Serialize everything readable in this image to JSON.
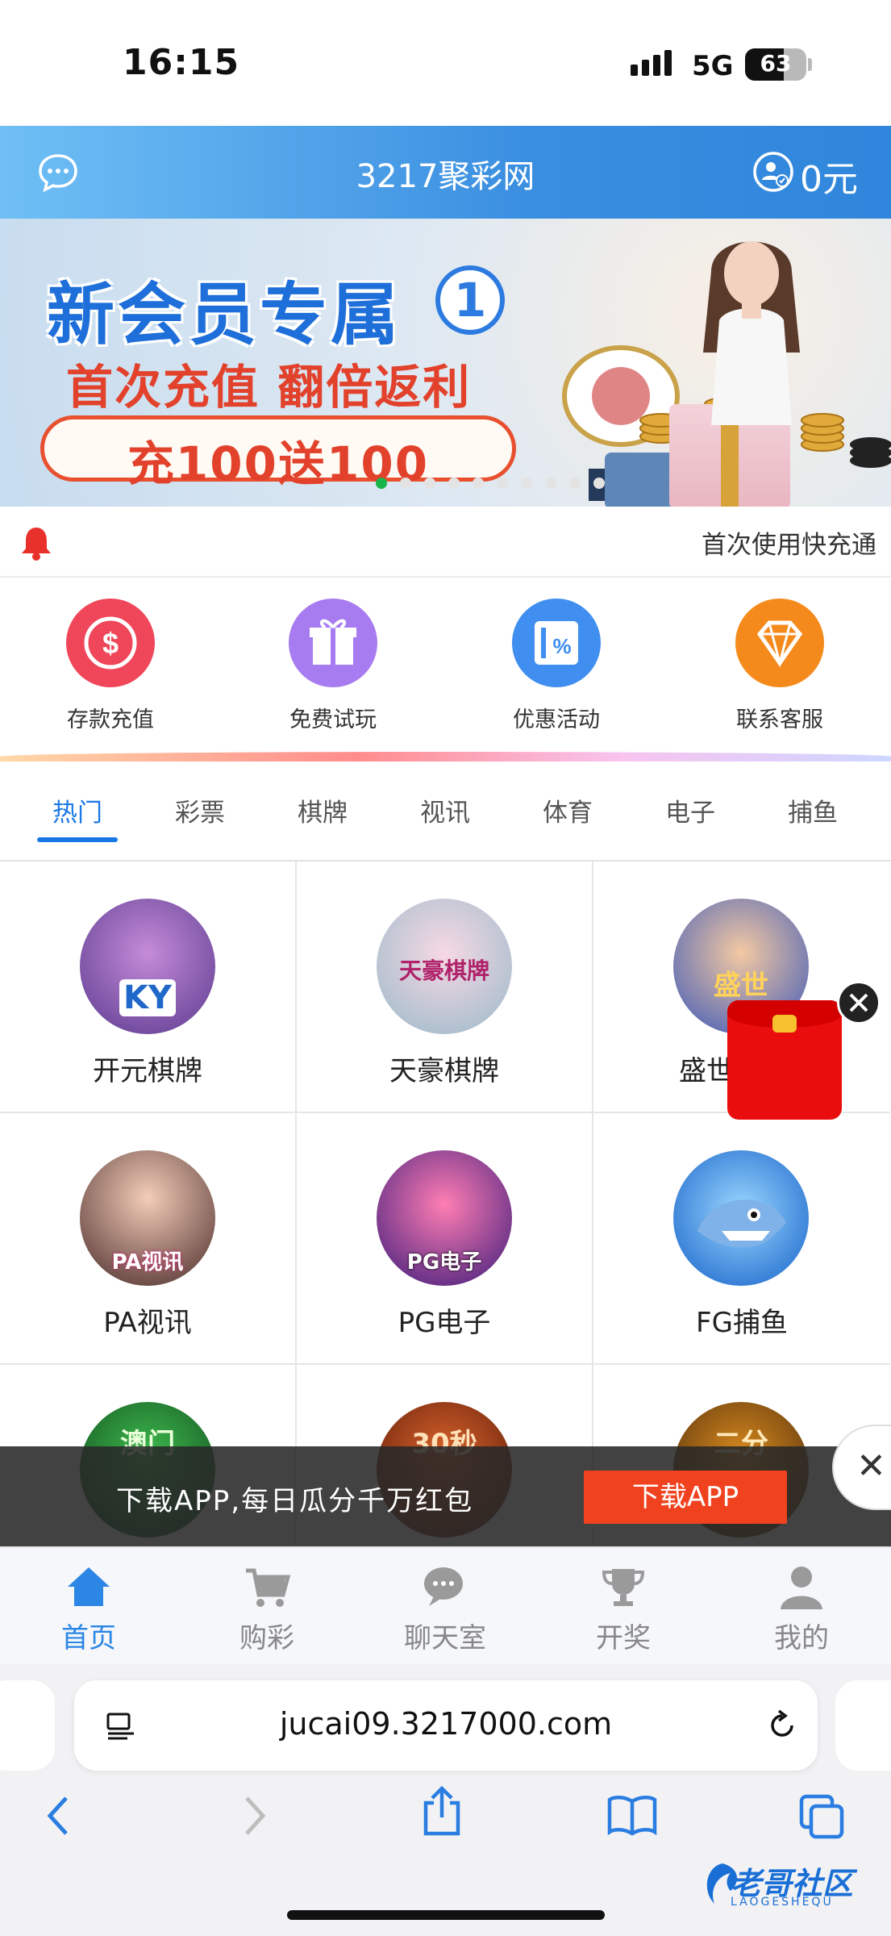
{
  "status_bar": {
    "time": "16:15",
    "network": "5G",
    "battery": "63"
  },
  "header": {
    "title": "3217聚彩网",
    "balance": "0元"
  },
  "banner": {
    "headline": "新会员专属",
    "badge": "1",
    "subline": "首次充值 翻倍返利",
    "offer": "充100送100",
    "dot_count": 10,
    "active_dot": 0
  },
  "notice": {
    "text": "首次使用快充通"
  },
  "quick_actions": [
    {
      "label": "存款充值",
      "icon": "dollar-icon",
      "color": "#f0465a"
    },
    {
      "label": "免费试玩",
      "icon": "gift-icon",
      "color": "#a77cf0"
    },
    {
      "label": "优惠活动",
      "icon": "coupon-icon",
      "color": "#3f8ef0"
    },
    {
      "label": "联系客服",
      "icon": "diamond-icon",
      "color": "#f58a1c"
    }
  ],
  "tabs": [
    "热门",
    "彩票",
    "棋牌",
    "视讯",
    "体育",
    "电子",
    "捕鱼"
  ],
  "active_tab": "热门",
  "games": [
    {
      "name": "开元棋牌",
      "badge": "KY"
    },
    {
      "name": "天豪棋牌",
      "badge": "天豪棋牌"
    },
    {
      "name": "盛世",
      "badge": "盛世"
    },
    {
      "name": "PA视讯",
      "badge": "PA视讯"
    },
    {
      "name": "PG电子",
      "badge": "PG电子"
    },
    {
      "name": "FG捕鱼",
      "badge": ""
    },
    {
      "name": "",
      "badge": "澳门"
    },
    {
      "name": "",
      "badge": "30秒"
    },
    {
      "name": "",
      "badge": "二分"
    }
  ],
  "download_bar": {
    "text": "下载APP,每日瓜分千万红包",
    "button": "下载APP"
  },
  "bottom_nav": [
    {
      "label": "首页",
      "icon": "home-icon",
      "active": true
    },
    {
      "label": "购彩",
      "icon": "cart-icon",
      "active": false
    },
    {
      "label": "聊天室",
      "icon": "chat-bubbles-icon",
      "active": false
    },
    {
      "label": "开奖",
      "icon": "trophy-icon",
      "active": false
    },
    {
      "label": "我的",
      "icon": "person-icon",
      "active": false
    }
  ],
  "browser": {
    "url": "jucai09.3217000.com"
  },
  "watermark": {
    "text": "老哥社区",
    "sub": "LAOGESHEQU"
  }
}
